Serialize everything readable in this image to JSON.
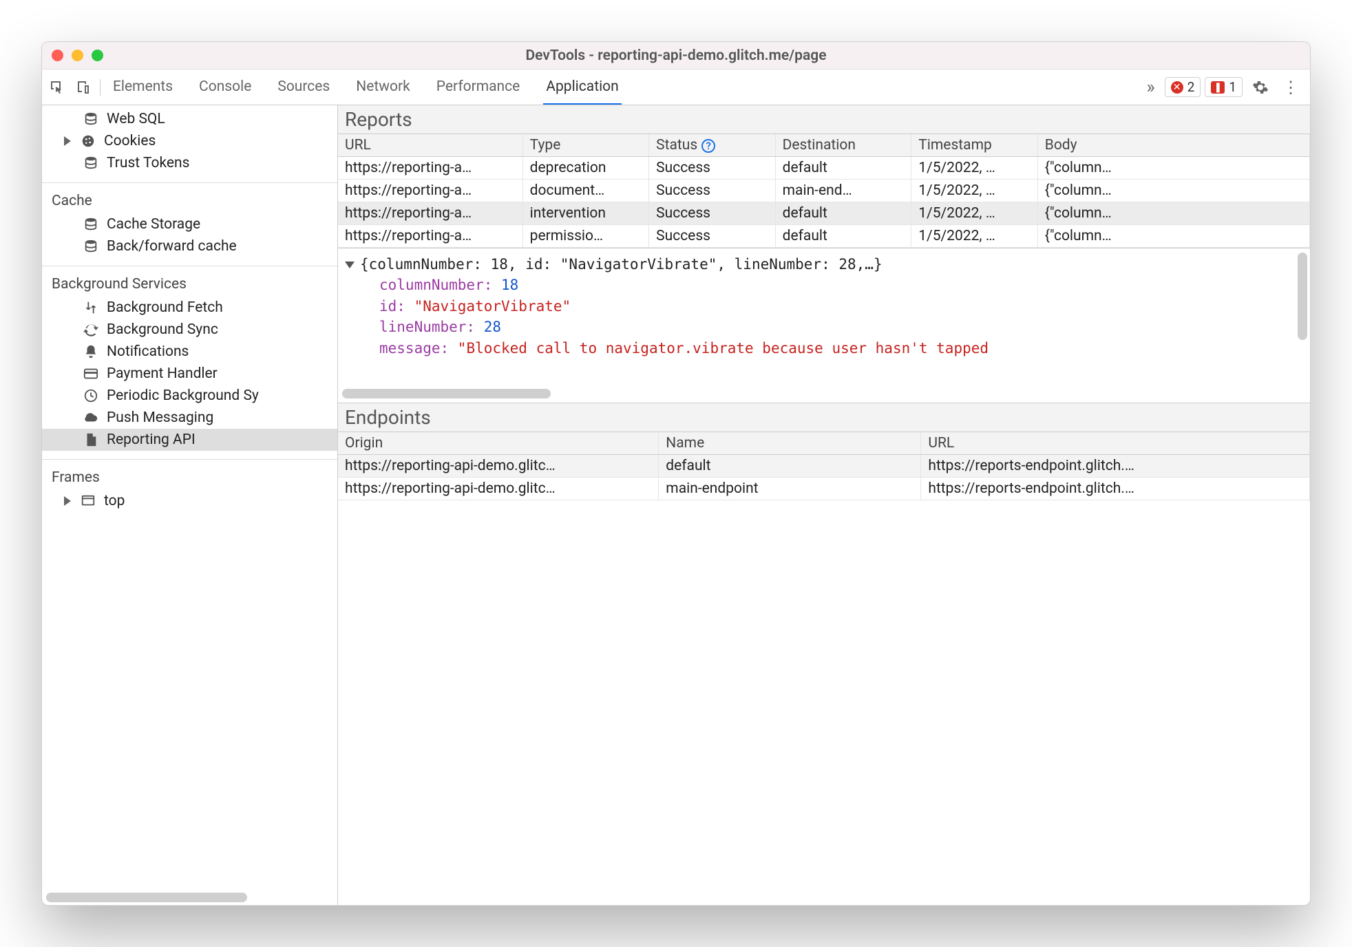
{
  "window": {
    "title": "DevTools - reporting-api-demo.glitch.me/page"
  },
  "tabs": {
    "items": [
      "Elements",
      "Console",
      "Sources",
      "Network",
      "Performance",
      "Application"
    ],
    "active": "Application",
    "errors_count": "2",
    "issues_count": "1"
  },
  "sidebar": {
    "storage_items": [
      {
        "icon": "database",
        "label": "Web SQL"
      },
      {
        "icon": "cookies",
        "label": "Cookies",
        "expandable": true
      },
      {
        "icon": "database",
        "label": "Trust Tokens"
      }
    ],
    "cache_heading": "Cache",
    "cache_items": [
      {
        "icon": "database",
        "label": "Cache Storage"
      },
      {
        "icon": "database",
        "label": "Back/forward cache"
      }
    ],
    "bg_heading": "Background Services",
    "bg_items": [
      {
        "icon": "updown",
        "label": "Background Fetch"
      },
      {
        "icon": "sync",
        "label": "Background Sync"
      },
      {
        "icon": "bell",
        "label": "Notifications"
      },
      {
        "icon": "card",
        "label": "Payment Handler"
      },
      {
        "icon": "clock",
        "label": "Periodic Background Sy"
      },
      {
        "icon": "cloud",
        "label": "Push Messaging"
      },
      {
        "icon": "file",
        "label": "Reporting API",
        "selected": true
      }
    ],
    "frames_heading": "Frames",
    "frames_items": [
      {
        "icon": "frame",
        "label": "top",
        "expandable": true
      }
    ]
  },
  "reports": {
    "title": "Reports",
    "columns": [
      "URL",
      "Type",
      "Status",
      "Destination",
      "Timestamp",
      "Body"
    ],
    "rows": [
      {
        "url": "https://reporting-a…",
        "type": "deprecation",
        "status": "Success",
        "dest": "default",
        "ts": "1/5/2022, …",
        "body": "{\"column…"
      },
      {
        "url": "https://reporting-a…",
        "type": "document…",
        "status": "Success",
        "dest": "main-end…",
        "ts": "1/5/2022, …",
        "body": "{\"column…"
      },
      {
        "url": "https://reporting-a…",
        "type": "intervention",
        "status": "Success",
        "dest": "default",
        "ts": "1/5/2022, …",
        "body": "{\"column…",
        "selected": true
      },
      {
        "url": "https://reporting-a…",
        "type": "permissio…",
        "status": "Success",
        "dest": "default",
        "ts": "1/5/2022, …",
        "body": "{\"column…"
      }
    ]
  },
  "detail": {
    "summary": "{columnNumber: 18, id: \"NavigatorVibrate\", lineNumber: 28,…}",
    "entries": [
      {
        "key": "columnNumber",
        "value": "18",
        "type": "num"
      },
      {
        "key": "id",
        "value": "\"NavigatorVibrate\"",
        "type": "str"
      },
      {
        "key": "lineNumber",
        "value": "28",
        "type": "num"
      },
      {
        "key": "message",
        "value": "\"Blocked call to navigator.vibrate because user hasn't tapped",
        "type": "str"
      }
    ]
  },
  "endpoints": {
    "title": "Endpoints",
    "columns": [
      "Origin",
      "Name",
      "URL"
    ],
    "rows": [
      {
        "origin": "https://reporting-api-demo.glitc…",
        "name": "default",
        "url": "https://reports-endpoint.glitch.…"
      },
      {
        "origin": "https://reporting-api-demo.glitc…",
        "name": "main-endpoint",
        "url": "https://reports-endpoint.glitch.…"
      }
    ]
  }
}
